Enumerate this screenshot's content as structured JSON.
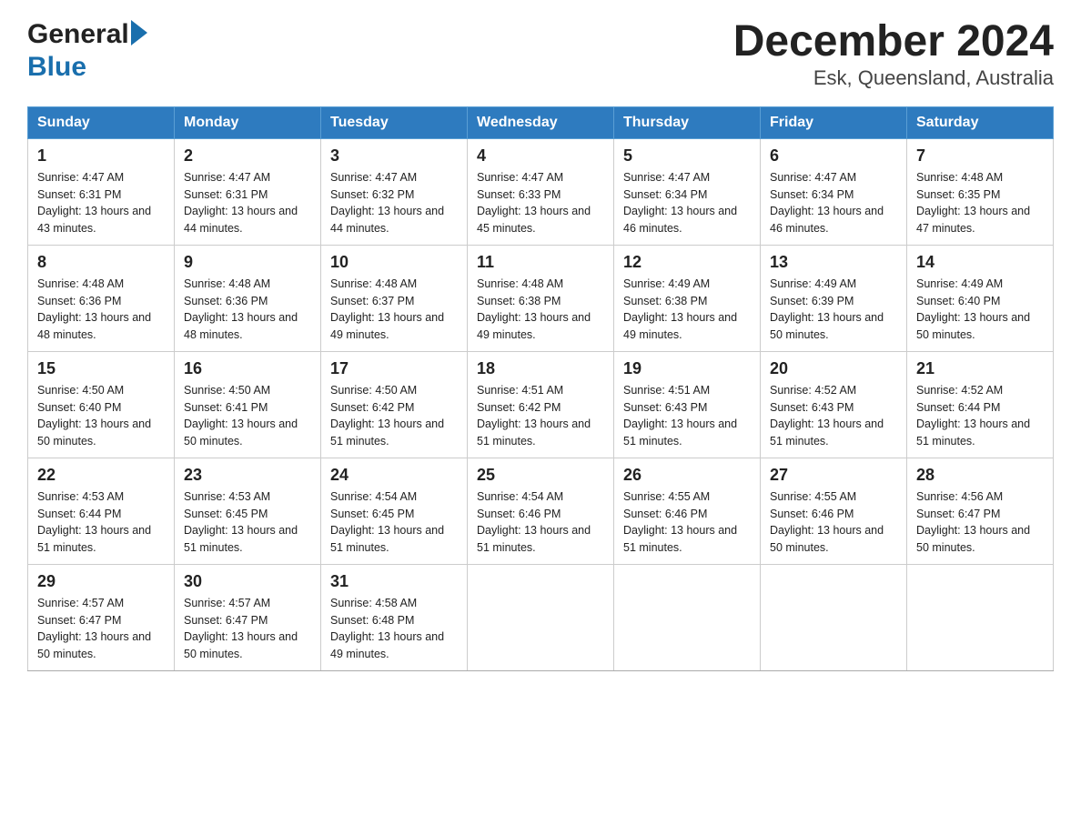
{
  "header": {
    "logo_general": "General",
    "logo_blue": "Blue",
    "title": "December 2024",
    "subtitle": "Esk, Queensland, Australia"
  },
  "calendar": {
    "days_of_week": [
      "Sunday",
      "Monday",
      "Tuesday",
      "Wednesday",
      "Thursday",
      "Friday",
      "Saturday"
    ],
    "weeks": [
      [
        {
          "day": "1",
          "sunrise": "4:47 AM",
          "sunset": "6:31 PM",
          "daylight": "13 hours and 43 minutes."
        },
        {
          "day": "2",
          "sunrise": "4:47 AM",
          "sunset": "6:31 PM",
          "daylight": "13 hours and 44 minutes."
        },
        {
          "day": "3",
          "sunrise": "4:47 AM",
          "sunset": "6:32 PM",
          "daylight": "13 hours and 44 minutes."
        },
        {
          "day": "4",
          "sunrise": "4:47 AM",
          "sunset": "6:33 PM",
          "daylight": "13 hours and 45 minutes."
        },
        {
          "day": "5",
          "sunrise": "4:47 AM",
          "sunset": "6:34 PM",
          "daylight": "13 hours and 46 minutes."
        },
        {
          "day": "6",
          "sunrise": "4:47 AM",
          "sunset": "6:34 PM",
          "daylight": "13 hours and 46 minutes."
        },
        {
          "day": "7",
          "sunrise": "4:48 AM",
          "sunset": "6:35 PM",
          "daylight": "13 hours and 47 minutes."
        }
      ],
      [
        {
          "day": "8",
          "sunrise": "4:48 AM",
          "sunset": "6:36 PM",
          "daylight": "13 hours and 48 minutes."
        },
        {
          "day": "9",
          "sunrise": "4:48 AM",
          "sunset": "6:36 PM",
          "daylight": "13 hours and 48 minutes."
        },
        {
          "day": "10",
          "sunrise": "4:48 AM",
          "sunset": "6:37 PM",
          "daylight": "13 hours and 49 minutes."
        },
        {
          "day": "11",
          "sunrise": "4:48 AM",
          "sunset": "6:38 PM",
          "daylight": "13 hours and 49 minutes."
        },
        {
          "day": "12",
          "sunrise": "4:49 AM",
          "sunset": "6:38 PM",
          "daylight": "13 hours and 49 minutes."
        },
        {
          "day": "13",
          "sunrise": "4:49 AM",
          "sunset": "6:39 PM",
          "daylight": "13 hours and 50 minutes."
        },
        {
          "day": "14",
          "sunrise": "4:49 AM",
          "sunset": "6:40 PM",
          "daylight": "13 hours and 50 minutes."
        }
      ],
      [
        {
          "day": "15",
          "sunrise": "4:50 AM",
          "sunset": "6:40 PM",
          "daylight": "13 hours and 50 minutes."
        },
        {
          "day": "16",
          "sunrise": "4:50 AM",
          "sunset": "6:41 PM",
          "daylight": "13 hours and 50 minutes."
        },
        {
          "day": "17",
          "sunrise": "4:50 AM",
          "sunset": "6:42 PM",
          "daylight": "13 hours and 51 minutes."
        },
        {
          "day": "18",
          "sunrise": "4:51 AM",
          "sunset": "6:42 PM",
          "daylight": "13 hours and 51 minutes."
        },
        {
          "day": "19",
          "sunrise": "4:51 AM",
          "sunset": "6:43 PM",
          "daylight": "13 hours and 51 minutes."
        },
        {
          "day": "20",
          "sunrise": "4:52 AM",
          "sunset": "6:43 PM",
          "daylight": "13 hours and 51 minutes."
        },
        {
          "day": "21",
          "sunrise": "4:52 AM",
          "sunset": "6:44 PM",
          "daylight": "13 hours and 51 minutes."
        }
      ],
      [
        {
          "day": "22",
          "sunrise": "4:53 AM",
          "sunset": "6:44 PM",
          "daylight": "13 hours and 51 minutes."
        },
        {
          "day": "23",
          "sunrise": "4:53 AM",
          "sunset": "6:45 PM",
          "daylight": "13 hours and 51 minutes."
        },
        {
          "day": "24",
          "sunrise": "4:54 AM",
          "sunset": "6:45 PM",
          "daylight": "13 hours and 51 minutes."
        },
        {
          "day": "25",
          "sunrise": "4:54 AM",
          "sunset": "6:46 PM",
          "daylight": "13 hours and 51 minutes."
        },
        {
          "day": "26",
          "sunrise": "4:55 AM",
          "sunset": "6:46 PM",
          "daylight": "13 hours and 51 minutes."
        },
        {
          "day": "27",
          "sunrise": "4:55 AM",
          "sunset": "6:46 PM",
          "daylight": "13 hours and 50 minutes."
        },
        {
          "day": "28",
          "sunrise": "4:56 AM",
          "sunset": "6:47 PM",
          "daylight": "13 hours and 50 minutes."
        }
      ],
      [
        {
          "day": "29",
          "sunrise": "4:57 AM",
          "sunset": "6:47 PM",
          "daylight": "13 hours and 50 minutes."
        },
        {
          "day": "30",
          "sunrise": "4:57 AM",
          "sunset": "6:47 PM",
          "daylight": "13 hours and 50 minutes."
        },
        {
          "day": "31",
          "sunrise": "4:58 AM",
          "sunset": "6:48 PM",
          "daylight": "13 hours and 49 minutes."
        },
        null,
        null,
        null,
        null
      ]
    ]
  }
}
